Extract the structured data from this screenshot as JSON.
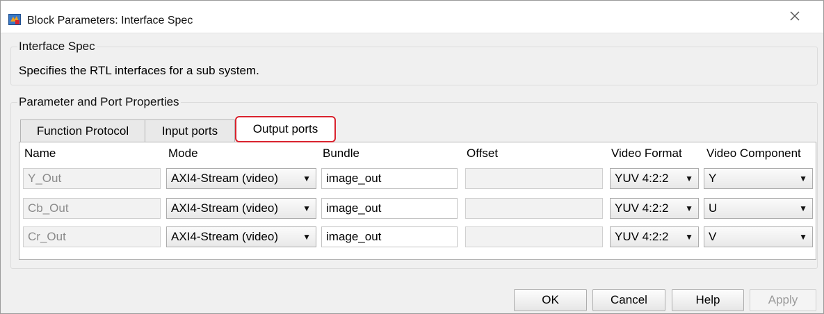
{
  "window": {
    "title": "Block Parameters: Interface Spec"
  },
  "interface_group": {
    "title": "Interface Spec",
    "description": "Specifies the RTL interfaces for a sub system."
  },
  "params_group": {
    "title": "Parameter and Port Properties"
  },
  "tabs": [
    {
      "label": "Function Protocol",
      "active": false
    },
    {
      "label": "Input ports",
      "active": false
    },
    {
      "label": "Output ports",
      "active": true
    }
  ],
  "columns": [
    "Name",
    "Mode",
    "Bundle",
    "Offset",
    "Video Format",
    "Video Component"
  ],
  "rows": [
    {
      "name": "Y_Out",
      "mode": "AXI4-Stream (video)",
      "bundle": "image_out",
      "offset": "",
      "video_format": "YUV 4:2:2",
      "video_component": "Y"
    },
    {
      "name": "Cb_Out",
      "mode": "AXI4-Stream (video)",
      "bundle": "image_out",
      "offset": "",
      "video_format": "YUV 4:2:2",
      "video_component": "U"
    },
    {
      "name": "Cr_Out",
      "mode": "AXI4-Stream (video)",
      "bundle": "image_out",
      "offset": "",
      "video_format": "YUV 4:2:2",
      "video_component": "V"
    }
  ],
  "buttons": {
    "ok": "OK",
    "cancel": "Cancel",
    "help": "Help",
    "apply": "Apply"
  },
  "colors": {
    "active_tab_highlight": "#d9232e"
  }
}
